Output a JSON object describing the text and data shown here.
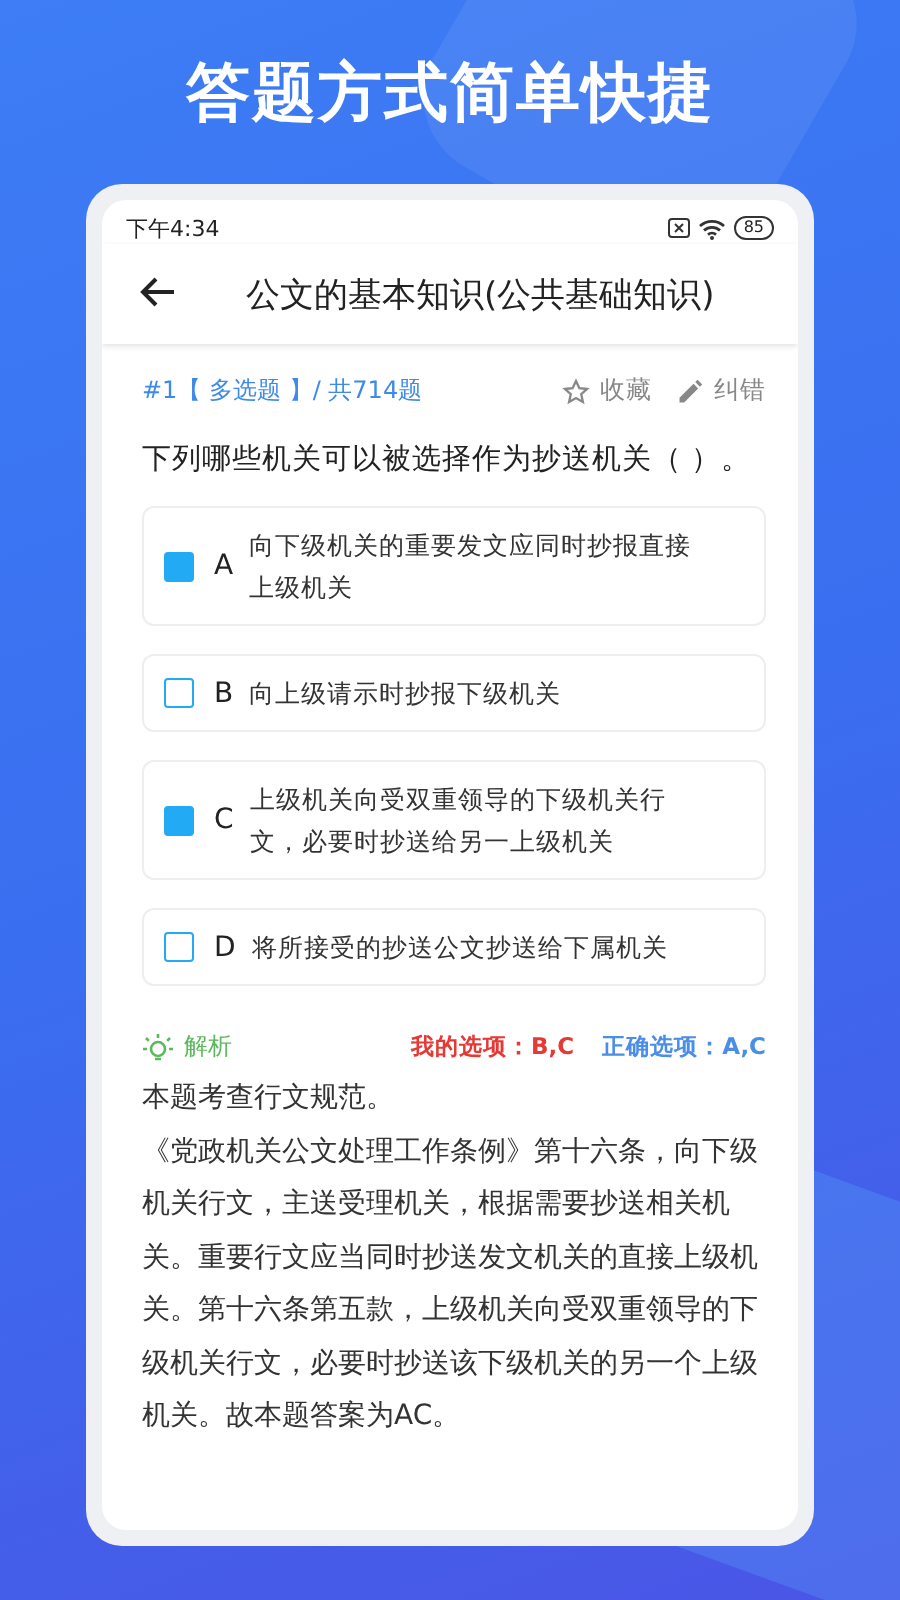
{
  "headline": "答题方式简单快捷",
  "status_bar": {
    "time": "下午4:34",
    "battery": "85"
  },
  "app_bar": {
    "title": "公文的基本知识(公共基础知识)"
  },
  "question_meta": {
    "number": "#1【 多选题 】/ 共714题",
    "favorite": "收藏",
    "report": "纠错"
  },
  "question": "下列哪些机关可以被选择作为抄送机关（   ）。",
  "options": [
    {
      "letter": "A",
      "text": "向下级机关的重要发文应同时抄报直接上级机关",
      "checked": true
    },
    {
      "letter": "B",
      "text": "向上级请示时抄报下级机关",
      "checked": false
    },
    {
      "letter": "C",
      "text": "上级机关向受双重领导的下级机关行文，必要时抄送给另一上级机关",
      "checked": true
    },
    {
      "letter": "D",
      "text": "将所接受的抄送公文抄送给下属机关",
      "checked": false
    }
  ],
  "analysis": {
    "label": "解析",
    "my_answer": "我的选项：B,C",
    "correct_answer": "正确选项：A,C",
    "paragraphs": [
      "本题考查行文规范。",
      "《党政机关公文处理工作条例》第十六条，向下级机关行文，主送受理机关，根据需要抄送相关机关。重要行文应当同时抄送发文机关的直接上级机关。第十六条第五款，上级机关向受双重领导的下级机关行文，必要时抄送该下级机关的另一个上级机关。故本题答案为AC。"
    ]
  }
}
